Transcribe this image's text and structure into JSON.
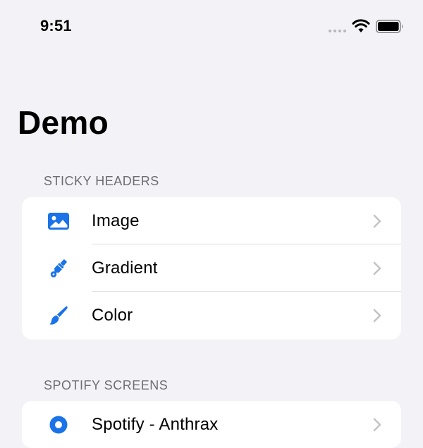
{
  "status_bar": {
    "time": "9:51",
    "icons": [
      "signal-dots-icon",
      "wifi-icon",
      "battery-icon"
    ]
  },
  "page": {
    "title": "Demo"
  },
  "sections": [
    {
      "header": "STICKY HEADERS",
      "rows": [
        {
          "label": "Image",
          "icon": "photo-icon"
        },
        {
          "label": "Gradient",
          "icon": "paintbrush-pointed-icon"
        },
        {
          "label": "Color",
          "icon": "paintbrush-icon"
        }
      ]
    },
    {
      "header": "SPOTIFY SCREENS",
      "rows": [
        {
          "label": "Spotify - Anthrax",
          "icon": "record-circle-icon"
        }
      ]
    }
  ],
  "colors": {
    "accent": "#1a73e8",
    "background": "#f2f2f7",
    "card": "#ffffff",
    "secondary_text": "#6d6d72",
    "chevron": "#c4c4c7"
  }
}
